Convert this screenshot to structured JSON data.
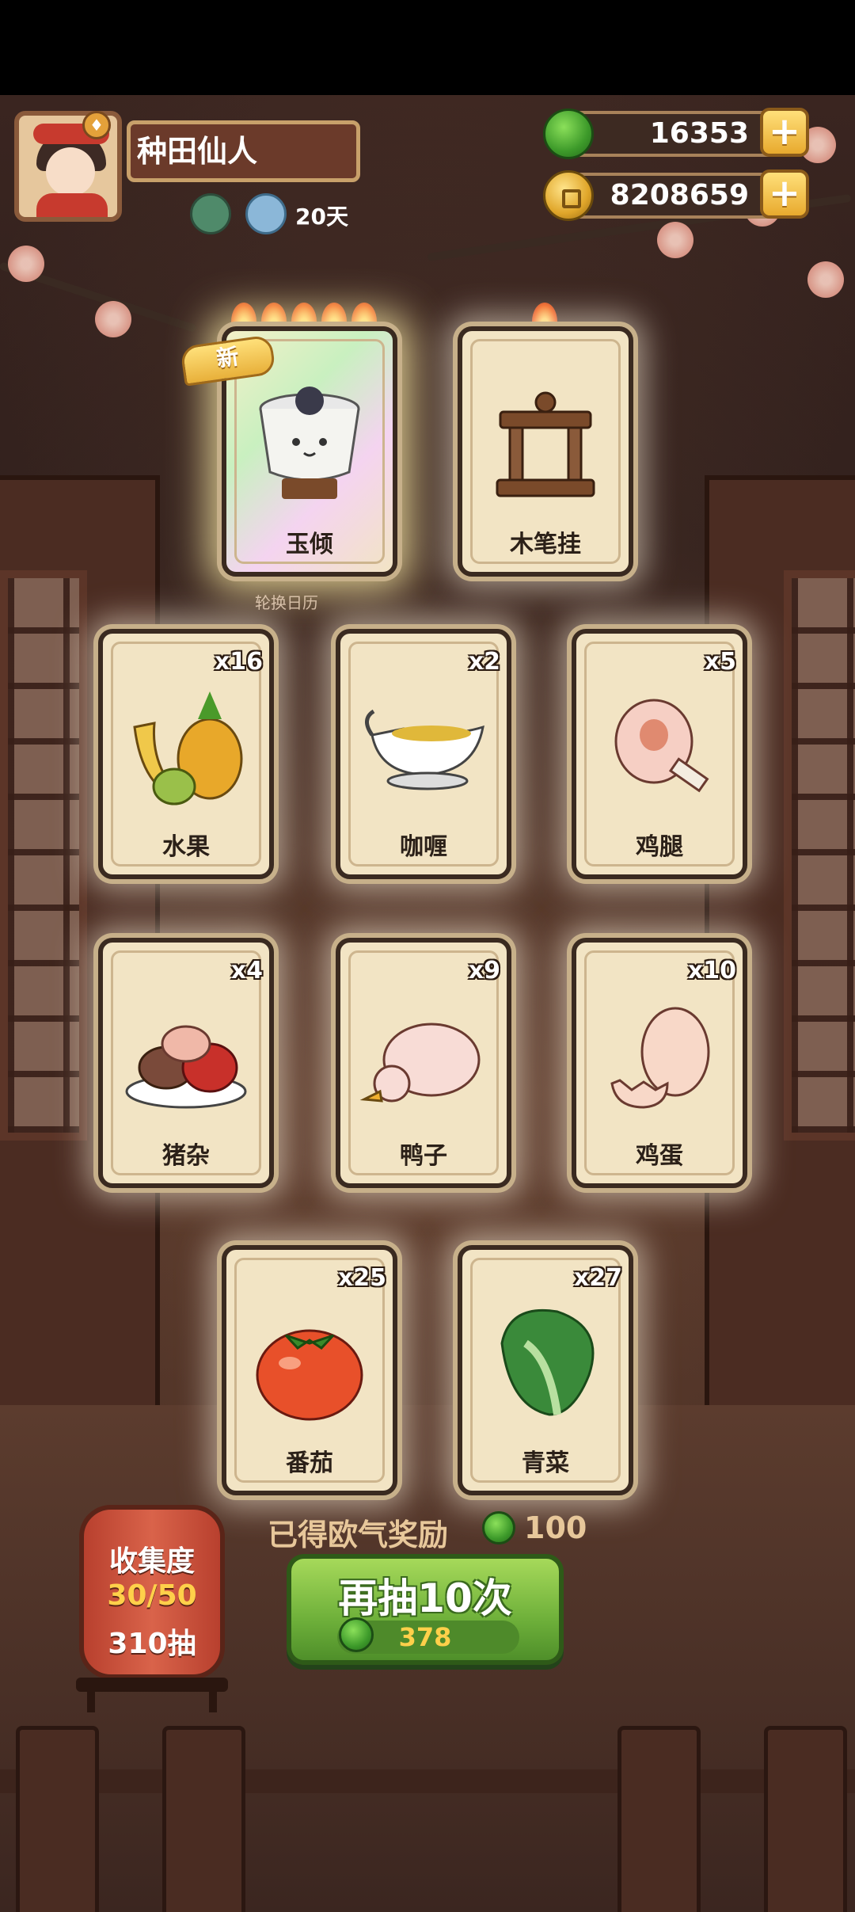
{
  "player": {
    "name": "种田仙人",
    "days": "20天"
  },
  "resources": {
    "jade": "16353",
    "coins": "8208659"
  },
  "new_badge": "新",
  "calendar_caption": "轮换日历",
  "featured_cards": [
    {
      "label": "玉倾",
      "flames": 5,
      "is_new": true
    },
    {
      "label": "木笔挂",
      "flames": 1,
      "is_new": false
    }
  ],
  "ingredient_cards": [
    {
      "label": "水果",
      "count": "x16"
    },
    {
      "label": "咖喱",
      "count": "x2"
    },
    {
      "label": "鸡腿",
      "count": "x5"
    },
    {
      "label": "猪杂",
      "count": "x4"
    },
    {
      "label": "鸭子",
      "count": "x9"
    },
    {
      "label": "鸡蛋",
      "count": "x10"
    },
    {
      "label": "番茄",
      "count": "x25"
    },
    {
      "label": "青菜",
      "count": "x27"
    }
  ],
  "reward": {
    "text": "已得欧气奖励",
    "value": "100"
  },
  "draw_button": {
    "label": "再抽10次",
    "cost": "378"
  },
  "collection": {
    "title": "收集度",
    "progress": "30/50",
    "draws": "310抽"
  },
  "colors": {
    "jade_green": "#3d9a2a",
    "gold": "#e8aa2e",
    "button_green": "#6eb03a",
    "lantern_red": "#d9634a"
  }
}
